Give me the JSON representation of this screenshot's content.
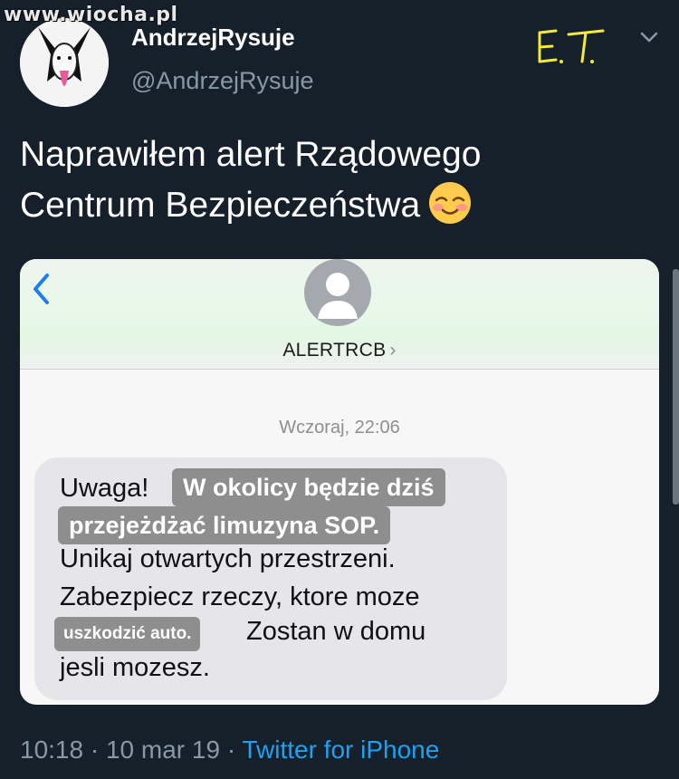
{
  "watermark": "www.wiocha.pl",
  "author": {
    "display_name": "AndrzejRysuje",
    "handle": "@AndrzejRysuje"
  },
  "tweet": {
    "line1": "Naprawiłem alert Rządowego",
    "line2": "Centrum Bezpieczeństwa"
  },
  "annotation": "E.T.",
  "screenshot": {
    "contact": "ALERTRCB",
    "contact_chevron": "›",
    "timestamp": "Wczoraj, 22:06",
    "message": {
      "prefix": "Uwaga!",
      "overlay1": "W okolicy będzie dziś",
      "overlay2": "przejeżdżać limuzyna SOP.",
      "line3": "Unikaj otwartych przestrzeni.",
      "line4": "Zabezpiecz rzeczy, ktore moze",
      "overlay3": "uszkodzić auto.",
      "line5_rest": "Zostan w domu",
      "line6": "jesli mozesz."
    }
  },
  "footer": {
    "time": "10:18",
    "sep1": " · ",
    "date": "10 mar 19",
    "sep2": " · ",
    "source": "Twitter for iPhone"
  },
  "colors": {
    "background": "#15202b",
    "secondary_text": "#8899a6",
    "link": "#1da1f2",
    "bubble": "#e5e5ea",
    "overlay": "#8e8e8e"
  },
  "icons": {
    "more": "chevron-down-icon",
    "back": "back-chevron-icon",
    "contact": "person-silhouette-icon",
    "emoji": "smiling-face-with-blush-emoji"
  }
}
